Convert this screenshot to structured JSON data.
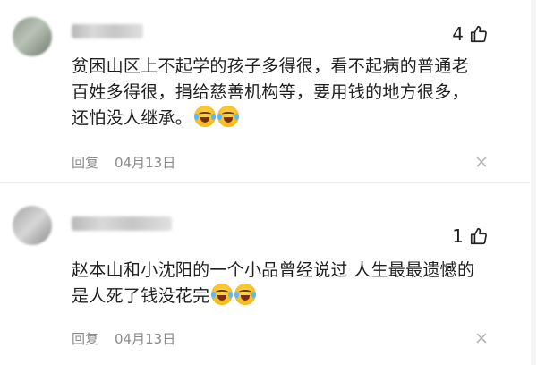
{
  "comments": [
    {
      "likes": "4",
      "text_lines": [
        "贫困山区上不起学的孩子多得很，看不起病的普通老",
        "百姓多得很，捐给慈善机构等，要用钱的地方很多，",
        "还怕没人继承。"
      ],
      "emojis": [
        "laugh-cry-emoji",
        "laugh-cry-emoji"
      ],
      "reply_label": "回复",
      "date": "04月13日"
    },
    {
      "likes": "1",
      "text_lines": [
        "赵本山和小沈阳的一个小品曾经说过 人生最最遗憾的",
        "是人死了钱没花完"
      ],
      "emojis": [
        "laugh-cry-emoji",
        "laugh-cry-emoji"
      ],
      "reply_label": "回复",
      "date": "04月13日"
    }
  ],
  "icons": {
    "like": "thumbs-up-icon",
    "close": "close-icon"
  },
  "colors": {
    "text": "#1f1f1f",
    "meta": "#8a8a8a",
    "divider": "#ededed"
  }
}
